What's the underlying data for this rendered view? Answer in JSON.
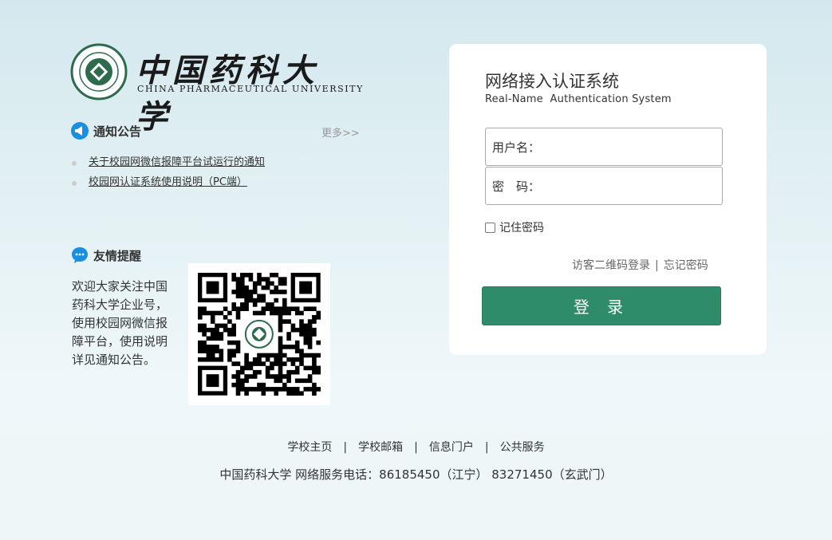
{
  "logo": {
    "cn": "中国药科大学",
    "en": "CHINA PHARMACEUTICAL UNIVERSITY"
  },
  "notice": {
    "title": "通知公告",
    "more": "更多>>",
    "items": [
      "关于校园网微信报障平台试运行的通知",
      "校园网认证系统使用说明（PC端）"
    ]
  },
  "tip": {
    "title": "友情提醒",
    "text": "欢迎大家关注中国药科大学企业号，使用校园网微信报障平台，使用说明详见通知公告。"
  },
  "login": {
    "title": "网络接入认证系统",
    "subtitle": "Real-Name  Authentication System",
    "username_label": "用户名：",
    "password_label": "密　码：",
    "remember": "记住密码",
    "guest_qr": "访客二维码登录",
    "separator": "|",
    "forgot": "忘记密码",
    "button": "登 录"
  },
  "footer": {
    "links": [
      "学校主页",
      "学校邮箱",
      "信息门户",
      "公共服务"
    ],
    "separator": "|",
    "info": "中国药科大学 网络服务电话：86185450（江宁） 83271450（玄武门）"
  },
  "colors": {
    "accent": "#2e8c6a",
    "icon_blue": "#1a8fe0"
  }
}
